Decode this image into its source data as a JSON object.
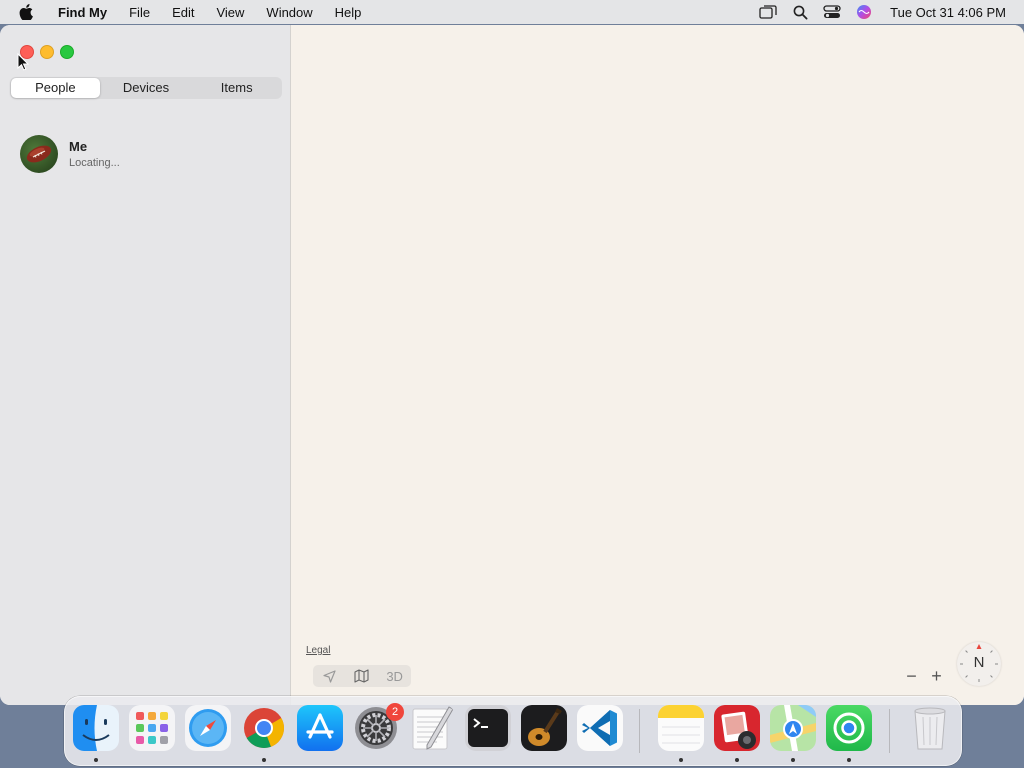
{
  "menubar": {
    "app_name": "Find My",
    "menus": [
      "File",
      "Edit",
      "View",
      "Window",
      "Help"
    ],
    "clock": "Tue Oct 31  4:06 PM"
  },
  "sidebar": {
    "tabs": [
      {
        "label": "People",
        "active": true
      },
      {
        "label": "Devices",
        "active": false
      },
      {
        "label": "Items",
        "active": false
      }
    ],
    "people": [
      {
        "name": "Me",
        "status": "Locating..."
      }
    ]
  },
  "map": {
    "legal_label": "Legal",
    "mode_3d_label": "3D",
    "zoom_out": "−",
    "zoom_in": "+",
    "compass_label": "N"
  },
  "dock": {
    "apps": [
      {
        "name": "finder-icon",
        "running": true
      },
      {
        "name": "launchpad-icon",
        "running": false
      },
      {
        "name": "safari-icon",
        "running": false
      },
      {
        "name": "chrome-icon",
        "running": true
      },
      {
        "name": "app-store-icon",
        "running": false
      },
      {
        "name": "system-settings-icon",
        "running": false,
        "badge": "2"
      },
      {
        "name": "textedit-icon",
        "running": false
      },
      {
        "name": "terminal-icon",
        "running": false
      },
      {
        "name": "garageband-icon",
        "running": false
      },
      {
        "name": "vscode-icon",
        "running": false
      },
      {
        "name": "notes-icon",
        "running": true
      },
      {
        "name": "photo-booth-icon",
        "running": true
      },
      {
        "name": "maps-icon",
        "running": true
      },
      {
        "name": "find-my-icon",
        "running": true
      },
      {
        "name": "trash-icon",
        "running": false
      }
    ]
  },
  "colors": {
    "close": "#fe5f57",
    "minimize": "#febc2e",
    "maximize": "#28c840",
    "badge": "#f0463c"
  }
}
